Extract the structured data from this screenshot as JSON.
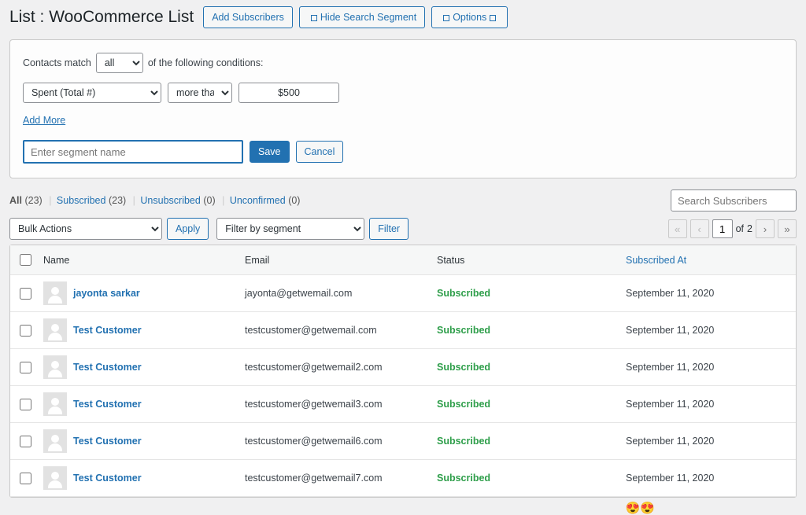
{
  "header": {
    "title_prefix": "List : ",
    "list_name": "WooCommerce List",
    "add_btn": "Add Subscribers",
    "hide_btn": "Hide Search Segment",
    "options_btn": "Options"
  },
  "segment": {
    "match_label_pre": "Contacts match",
    "match_mode": "all",
    "match_label_post": "of the following conditions:",
    "condition": {
      "field": "Spent (Total #)",
      "op": "more than",
      "value": "$500"
    },
    "add_more": "Add More",
    "name_placeholder": "Enter segment name",
    "save": "Save",
    "cancel": "Cancel"
  },
  "status_tabs": {
    "all": {
      "label": "All",
      "count": "(23)"
    },
    "subscribed": {
      "label": "Subscribed",
      "count": "(23)"
    },
    "unsubscribed": {
      "label": "Unsubscribed",
      "count": "(0)"
    },
    "unconfirmed": {
      "label": "Unconfirmed",
      "count": "(0)"
    }
  },
  "search_placeholder": "Search Subscribers",
  "actions": {
    "bulk": "Bulk Actions",
    "apply": "Apply",
    "seg_filter": "Filter by segment",
    "filter": "Filter"
  },
  "pager": {
    "current": "1",
    "of": "of",
    "total": "2"
  },
  "columns": {
    "name": "Name",
    "email": "Email",
    "status": "Status",
    "subscribed_at": "Subscribed At"
  },
  "rows": [
    {
      "name": "jayonta sarkar",
      "email": "jayonta@getwemail.com",
      "status": "Subscribed",
      "subscribed_at": "September 11, 2020"
    },
    {
      "name": "Test Customer",
      "email": "testcustomer@getwemail.com",
      "status": "Subscribed",
      "subscribed_at": "September 11, 2020"
    },
    {
      "name": "Test Customer",
      "email": "testcustomer@getwemail2.com",
      "status": "Subscribed",
      "subscribed_at": "September 11, 2020"
    },
    {
      "name": "Test Customer",
      "email": "testcustomer@getwemail3.com",
      "status": "Subscribed",
      "subscribed_at": "September 11, 2020"
    },
    {
      "name": "Test Customer",
      "email": "testcustomer@getwemail6.com",
      "status": "Subscribed",
      "subscribed_at": "September 11, 2020"
    },
    {
      "name": "Test Customer",
      "email": "testcustomer@getwemail7.com",
      "status": "Subscribed",
      "subscribed_at": "September 11, 2020"
    }
  ],
  "footer_emoji": "😍😍"
}
